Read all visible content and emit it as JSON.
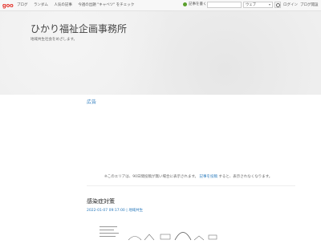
{
  "topbar": {
    "logo_text": "goo",
    "nav": [
      "ブログ",
      "ランダム",
      "人気の記事"
    ],
    "trend": "今週の出題 \"キャベツ\" をチェック",
    "write_label": "記事を書く",
    "search_select": "ウェブ",
    "login": "ログイン",
    "blog_open": "ブログ開設",
    "accent_color": "#5aa02c"
  },
  "header": {
    "blog_title": "ひかり福祉企画事務所",
    "description": "地域共生社会をめざします。"
  },
  "ad": {
    "label": "広告",
    "note_before": "※このエリアは、90日間投稿が無い場合に表示されます。",
    "note_link": "記事を投稿",
    "note_after": "すると、表示されなくなります。"
  },
  "entry": {
    "title": "感染症対策",
    "date": "2022-01-07 09:17:00",
    "category": "地域共生"
  }
}
